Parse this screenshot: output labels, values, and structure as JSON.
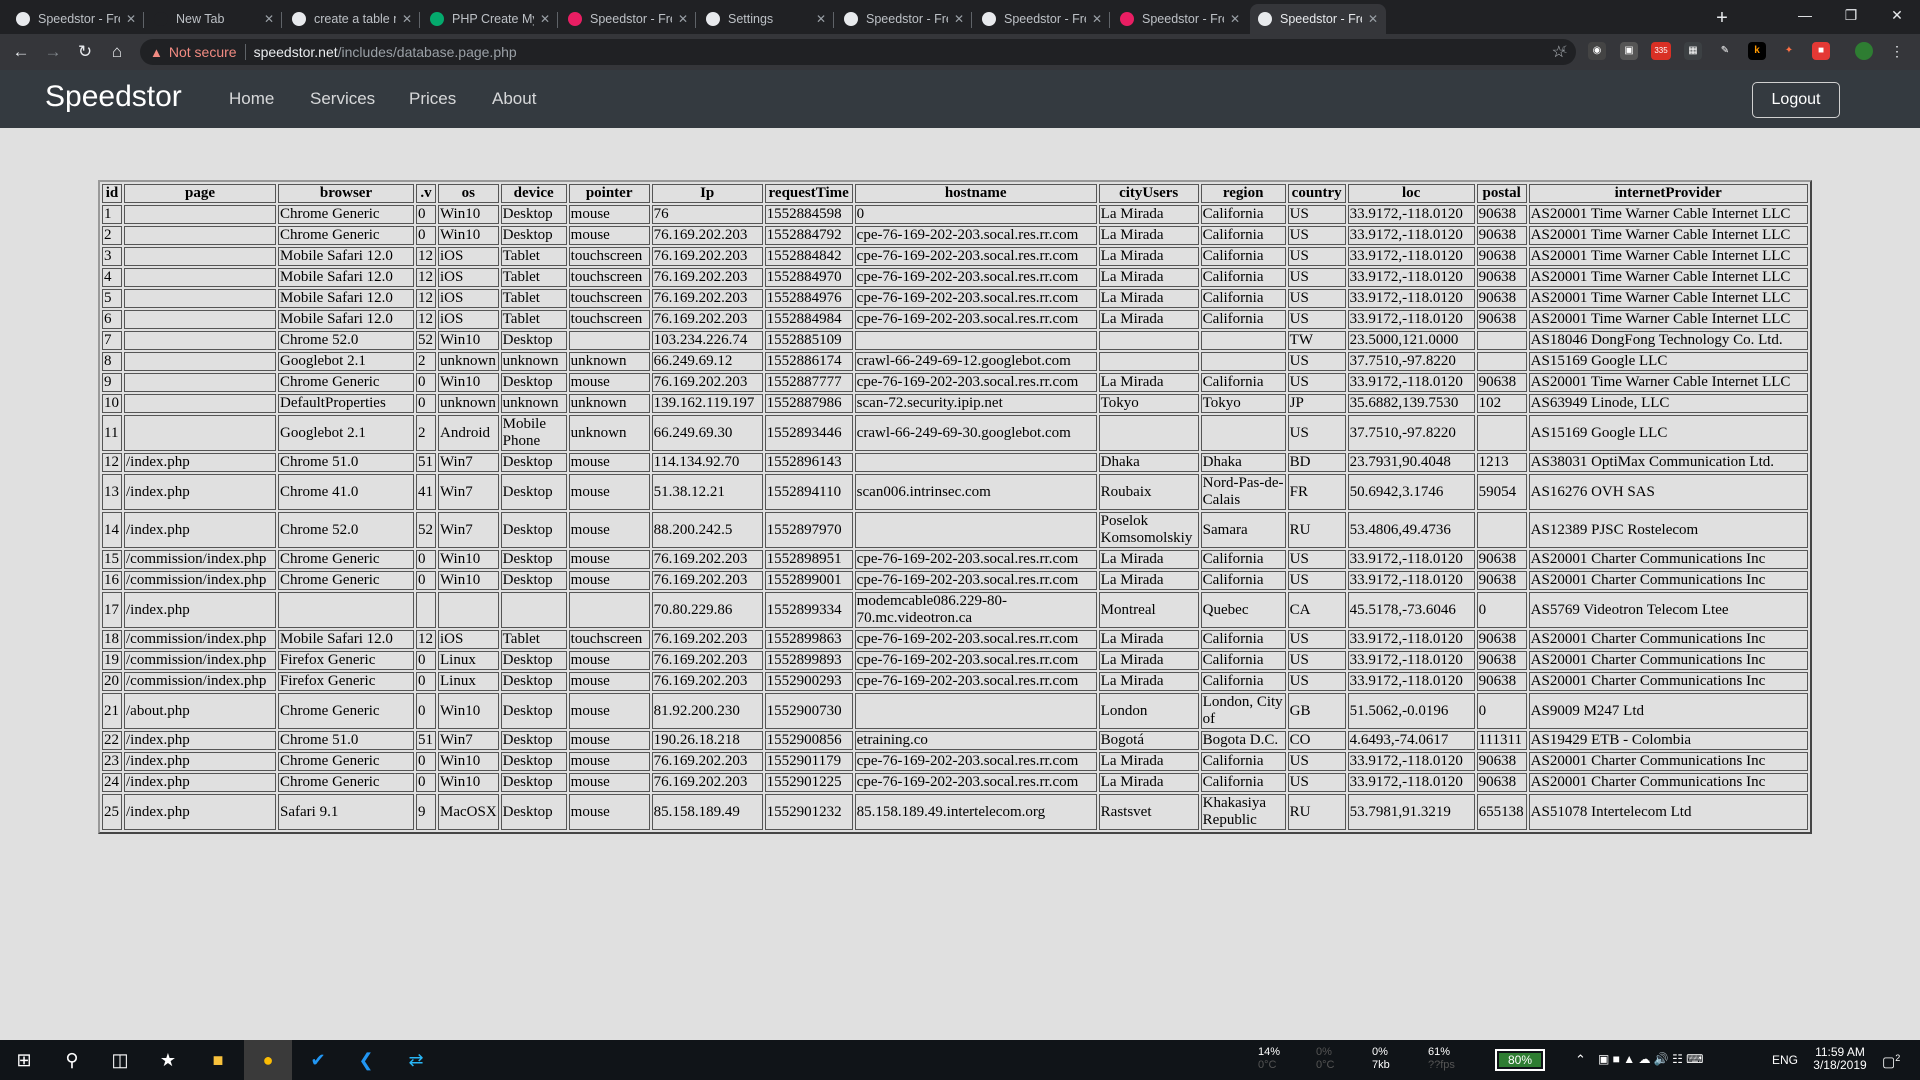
{
  "browser": {
    "tabs": [
      {
        "title": "Speedstor - Freelance",
        "fav": "globe-icon",
        "favColor": "#e8eaed"
      },
      {
        "title": "New Tab",
        "fav": "none",
        "favColor": "#202124"
      },
      {
        "title": "create a table mysql",
        "fav": "google-icon",
        "favColor": "#e8eaed"
      },
      {
        "title": "PHP Create MySQL",
        "fav": "w3-icon",
        "favColor": "#04aa6d"
      },
      {
        "title": "Speedstor - Freelance",
        "fav": "app-icon",
        "favColor": "#e91e63"
      },
      {
        "title": "Settings",
        "fav": "gear-icon",
        "favColor": "#e8eaed"
      },
      {
        "title": "Speedstor - Freelance",
        "fav": "globe-icon",
        "favColor": "#e8eaed"
      },
      {
        "title": "Speedstor - Freelance",
        "fav": "globe-icon",
        "favColor": "#e8eaed"
      },
      {
        "title": "Speedstor - Freelance",
        "fav": "app-icon",
        "favColor": "#e91e63"
      },
      {
        "title": "Speedstor - Freelance",
        "fav": "globe-icon",
        "favColor": "#e8eaed"
      }
    ],
    "security": "Not secure",
    "url_host": "speedstor.net",
    "url_path": "/includes/database.page.php",
    "badge_count": "335"
  },
  "site": {
    "brand": "Speedstor",
    "nav": [
      "Home",
      "Services",
      "Prices",
      "About"
    ],
    "logout": "Logout"
  },
  "table": {
    "headers": [
      "id",
      "page",
      "browser",
      ".v",
      "os",
      "device",
      "pointer",
      "Ip",
      "requestTime",
      "hostname",
      "cityUsers",
      "region",
      "country",
      "loc",
      "postal",
      "internetProvider"
    ],
    "rows": [
      [
        "1",
        "",
        "Chrome Generic",
        "0",
        "Win10",
        "Desktop",
        "mouse",
        "76",
        "1552884598",
        "0",
        "La Mirada",
        "California",
        "US",
        "33.9172,-118.0120",
        "90638",
        "AS20001 Time Warner Cable Internet LLC"
      ],
      [
        "2",
        "",
        "Chrome Generic",
        "0",
        "Win10",
        "Desktop",
        "mouse",
        "76.169.202.203",
        "1552884792",
        "cpe-76-169-202-203.socal.res.rr.com",
        "La Mirada",
        "California",
        "US",
        "33.9172,-118.0120",
        "90638",
        "AS20001 Time Warner Cable Internet LLC"
      ],
      [
        "3",
        "",
        "Mobile Safari 12.0",
        "12",
        "iOS",
        "Tablet",
        "touchscreen",
        "76.169.202.203",
        "1552884842",
        "cpe-76-169-202-203.socal.res.rr.com",
        "La Mirada",
        "California",
        "US",
        "33.9172,-118.0120",
        "90638",
        "AS20001 Time Warner Cable Internet LLC"
      ],
      [
        "4",
        "",
        "Mobile Safari 12.0",
        "12",
        "iOS",
        "Tablet",
        "touchscreen",
        "76.169.202.203",
        "1552884970",
        "cpe-76-169-202-203.socal.res.rr.com",
        "La Mirada",
        "California",
        "US",
        "33.9172,-118.0120",
        "90638",
        "AS20001 Time Warner Cable Internet LLC"
      ],
      [
        "5",
        "",
        "Mobile Safari 12.0",
        "12",
        "iOS",
        "Tablet",
        "touchscreen",
        "76.169.202.203",
        "1552884976",
        "cpe-76-169-202-203.socal.res.rr.com",
        "La Mirada",
        "California",
        "US",
        "33.9172,-118.0120",
        "90638",
        "AS20001 Time Warner Cable Internet LLC"
      ],
      [
        "6",
        "",
        "Mobile Safari 12.0",
        "12",
        "iOS",
        "Tablet",
        "touchscreen",
        "76.169.202.203",
        "1552884984",
        "cpe-76-169-202-203.socal.res.rr.com",
        "La Mirada",
        "California",
        "US",
        "33.9172,-118.0120",
        "90638",
        "AS20001 Time Warner Cable Internet LLC"
      ],
      [
        "7",
        "",
        "Chrome 52.0",
        "52",
        "Win10",
        "Desktop",
        "",
        "103.234.226.74",
        "1552885109",
        "",
        "",
        "",
        "TW",
        "23.5000,121.0000",
        "",
        "AS18046 DongFong Technology Co. Ltd."
      ],
      [
        "8",
        "",
        "Googlebot 2.1",
        "2",
        "unknown",
        "unknown",
        "unknown",
        "66.249.69.12",
        "1552886174",
        "crawl-66-249-69-12.googlebot.com",
        "",
        "",
        "US",
        "37.7510,-97.8220",
        "",
        "AS15169 Google LLC"
      ],
      [
        "9",
        "",
        "Chrome Generic",
        "0",
        "Win10",
        "Desktop",
        "mouse",
        "76.169.202.203",
        "1552887777",
        "cpe-76-169-202-203.socal.res.rr.com",
        "La Mirada",
        "California",
        "US",
        "33.9172,-118.0120",
        "90638",
        "AS20001 Time Warner Cable Internet LLC"
      ],
      [
        "10",
        "",
        "DefaultProperties",
        "0",
        "unknown",
        "unknown",
        "unknown",
        "139.162.119.197",
        "1552887986",
        "scan-72.security.ipip.net",
        "Tokyo",
        "Tokyo",
        "JP",
        "35.6882,139.7530",
        "102",
        "AS63949 Linode, LLC"
      ],
      [
        "11",
        "",
        "Googlebot 2.1",
        "2",
        "Android",
        "Mobile Phone",
        "unknown",
        "66.249.69.30",
        "1552893446",
        "crawl-66-249-69-30.googlebot.com",
        "",
        "",
        "US",
        "37.7510,-97.8220",
        "",
        "AS15169 Google LLC"
      ],
      [
        "12",
        "/index.php",
        "Chrome 51.0",
        "51",
        "Win7",
        "Desktop",
        "mouse",
        "114.134.92.70",
        "1552896143",
        "",
        "Dhaka",
        "Dhaka",
        "BD",
        "23.7931,90.4048",
        "1213",
        "AS38031 OptiMax Communication Ltd."
      ],
      [
        "13",
        "/index.php",
        "Chrome 41.0",
        "41",
        "Win7",
        "Desktop",
        "mouse",
        "51.38.12.21",
        "1552894110",
        "scan006.intrinsec.com",
        "Roubaix",
        "Nord-Pas-de-Calais",
        "FR",
        "50.6942,3.1746",
        "59054",
        "AS16276 OVH SAS"
      ],
      [
        "14",
        "/index.php",
        "Chrome 52.0",
        "52",
        "Win7",
        "Desktop",
        "mouse",
        "88.200.242.5",
        "1552897970",
        "",
        "Poselok Komsomolskiy",
        "Samara",
        "RU",
        "53.4806,49.4736",
        "",
        "AS12389 PJSC Rostelecom"
      ],
      [
        "15",
        "/commission/index.php",
        "Chrome Generic",
        "0",
        "Win10",
        "Desktop",
        "mouse",
        "76.169.202.203",
        "1552898951",
        "cpe-76-169-202-203.socal.res.rr.com",
        "La Mirada",
        "California",
        "US",
        "33.9172,-118.0120",
        "90638",
        "AS20001 Charter Communications Inc"
      ],
      [
        "16",
        "/commission/index.php",
        "Chrome Generic",
        "0",
        "Win10",
        "Desktop",
        "mouse",
        "76.169.202.203",
        "1552899001",
        "cpe-76-169-202-203.socal.res.rr.com",
        "La Mirada",
        "California",
        "US",
        "33.9172,-118.0120",
        "90638",
        "AS20001 Charter Communications Inc"
      ],
      [
        "17",
        "/index.php",
        "",
        "",
        "",
        "",
        "",
        "70.80.229.86",
        "1552899334",
        "modemcable086.229-80-70.mc.videotron.ca",
        "Montreal",
        "Quebec",
        "CA",
        "45.5178,-73.6046",
        "0",
        "AS5769 Videotron Telecom Ltee"
      ],
      [
        "18",
        "/commission/index.php",
        "Mobile Safari 12.0",
        "12",
        "iOS",
        "Tablet",
        "touchscreen",
        "76.169.202.203",
        "1552899863",
        "cpe-76-169-202-203.socal.res.rr.com",
        "La Mirada",
        "California",
        "US",
        "33.9172,-118.0120",
        "90638",
        "AS20001 Charter Communications Inc"
      ],
      [
        "19",
        "/commission/index.php",
        "Firefox Generic",
        "0",
        "Linux",
        "Desktop",
        "mouse",
        "76.169.202.203",
        "1552899893",
        "cpe-76-169-202-203.socal.res.rr.com",
        "La Mirada",
        "California",
        "US",
        "33.9172,-118.0120",
        "90638",
        "AS20001 Charter Communications Inc"
      ],
      [
        "20",
        "/commission/index.php",
        "Firefox Generic",
        "0",
        "Linux",
        "Desktop",
        "mouse",
        "76.169.202.203",
        "1552900293",
        "cpe-76-169-202-203.socal.res.rr.com",
        "La Mirada",
        "California",
        "US",
        "33.9172,-118.0120",
        "90638",
        "AS20001 Charter Communications Inc"
      ],
      [
        "21",
        "/about.php",
        "Chrome Generic",
        "0",
        "Win10",
        "Desktop",
        "mouse",
        "81.92.200.230",
        "1552900730",
        "",
        "London",
        "London, City of",
        "GB",
        "51.5062,-0.0196",
        "0",
        "AS9009 M247 Ltd"
      ],
      [
        "22",
        "/index.php",
        "Chrome 51.0",
        "51",
        "Win7",
        "Desktop",
        "mouse",
        "190.26.18.218",
        "1552900856",
        "etraining.co",
        "Bogotá",
        "Bogota D.C.",
        "CO",
        "4.6493,-74.0617",
        "111311",
        "AS19429 ETB - Colombia"
      ],
      [
        "23",
        "/index.php",
        "Chrome Generic",
        "0",
        "Win10",
        "Desktop",
        "mouse",
        "76.169.202.203",
        "1552901179",
        "cpe-76-169-202-203.socal.res.rr.com",
        "La Mirada",
        "California",
        "US",
        "33.9172,-118.0120",
        "90638",
        "AS20001 Charter Communications Inc"
      ],
      [
        "24",
        "/index.php",
        "Chrome Generic",
        "0",
        "Win10",
        "Desktop",
        "mouse",
        "76.169.202.203",
        "1552901225",
        "cpe-76-169-202-203.socal.res.rr.com",
        "La Mirada",
        "California",
        "US",
        "33.9172,-118.0120",
        "90638",
        "AS20001 Charter Communications Inc"
      ],
      [
        "25",
        "/index.php",
        "Safari 9.1",
        "9",
        "MacOSX",
        "Desktop",
        "mouse",
        "85.158.189.49",
        "1552901232",
        "85.158.189.49.intertelecom.org",
        "Rastsvet",
        "Khakasiya Republic",
        "RU",
        "53.7981,91.3219",
        "655138",
        "AS51078 Intertelecom Ltd"
      ]
    ]
  },
  "taskbar": {
    "net_up": "14%",
    "net_up2": "0°C",
    "gpu": "0%",
    "gpu2": "0°C",
    "disk": "0%",
    "disk2": "7kb",
    "mem": "61%",
    "mem2": "??fps",
    "battery": "80%",
    "lang": "ENG",
    "time": "11:59 AM",
    "date": "3/18/2019",
    "notif": "2"
  },
  "colors": {
    "navbar": "#343a40",
    "page_bg": "#e0e0e0",
    "chrome_dark": "#202124",
    "chrome_toolbar": "#35363a"
  }
}
